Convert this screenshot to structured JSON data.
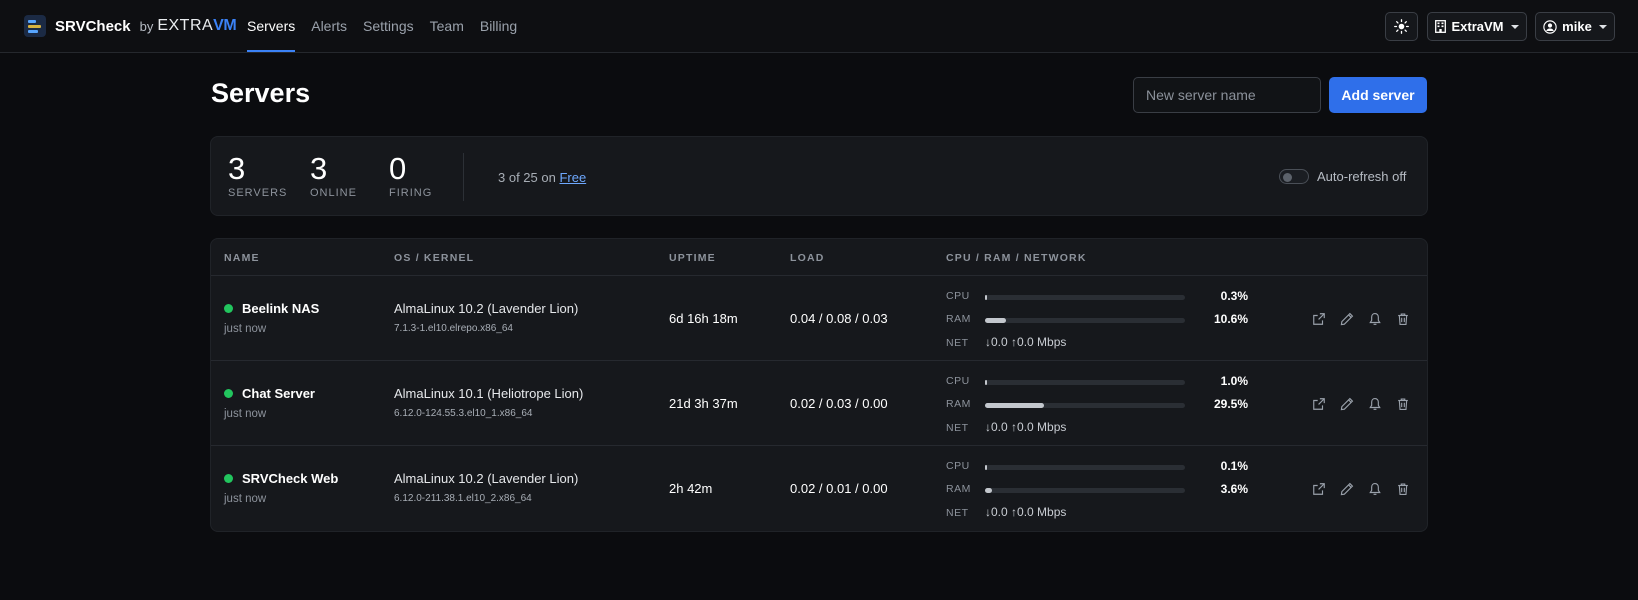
{
  "brand": {
    "name": "SRVCheck",
    "by": "by",
    "partner_extra": "EXTRA",
    "partner_vm": "VM"
  },
  "nav": {
    "links": [
      {
        "label": "Servers",
        "active": true
      },
      {
        "label": "Alerts",
        "active": false
      },
      {
        "label": "Settings",
        "active": false
      },
      {
        "label": "Team",
        "active": false
      },
      {
        "label": "Billing",
        "active": false
      }
    ],
    "theme_icon": "sun-icon",
    "org_label": "ExtraVM",
    "user_label": "mike"
  },
  "page": {
    "title": "Servers",
    "new_server_placeholder": "New server name",
    "add_server_label": "Add server"
  },
  "stats": {
    "servers": {
      "value": "3",
      "label": "SERVERS"
    },
    "online": {
      "value": "3",
      "label": "ONLINE"
    },
    "firing": {
      "value": "0",
      "label": "FIRING"
    },
    "plan_prefix": "3 of 25 on",
    "plan_name": "Free",
    "autorefresh_label": "Auto-refresh off",
    "autorefresh_on": false
  },
  "table": {
    "headers": {
      "name": "NAME",
      "os": "OS / KERNEL",
      "uptime": "UPTIME",
      "load": "LOAD",
      "metrics": "CPU / RAM / NETWORK"
    },
    "metric_labels": {
      "cpu": "CPU",
      "ram": "RAM",
      "net": "NET"
    },
    "status_color": "#22c55e",
    "rows": [
      {
        "name": "Beelink NAS",
        "last_seen": "just now",
        "os": "AlmaLinux 10.2 (Lavender Lion)",
        "kernel": "7.1.3-1.el10.elrepo.x86_64",
        "uptime": "6d 16h 18m",
        "load": "0.04 / 0.08 / 0.03",
        "cpu": "0.3%",
        "cpu_fraction": 0.003,
        "ram": "10.6%",
        "ram_fraction": 0.106,
        "net": "↓0.0  ↑0.0 Mbps"
      },
      {
        "name": "Chat Server",
        "last_seen": "just now",
        "os": "AlmaLinux 10.1 (Heliotrope Lion)",
        "kernel": "6.12.0-124.55.3.el10_1.x86_64",
        "uptime": "21d 3h 37m",
        "load": "0.02 / 0.03 / 0.00",
        "cpu": "1.0%",
        "cpu_fraction": 0.01,
        "ram": "29.5%",
        "ram_fraction": 0.295,
        "net": "↓0.0  ↑0.0 Mbps"
      },
      {
        "name": "SRVCheck Web",
        "last_seen": "just now",
        "os": "AlmaLinux 10.2 (Lavender Lion)",
        "kernel": "6.12.0-211.38.1.el10_2.x86_64",
        "uptime": "2h 42m",
        "load": "0.02 / 0.01 / 0.00",
        "cpu": "0.1%",
        "cpu_fraction": 0.001,
        "ram": "3.6%",
        "ram_fraction": 0.036,
        "net": "↓0.0  ↑0.0 Mbps"
      }
    ],
    "row_action_icons": [
      "external-link-icon",
      "pencil-icon",
      "bell-icon",
      "trash-icon"
    ]
  }
}
